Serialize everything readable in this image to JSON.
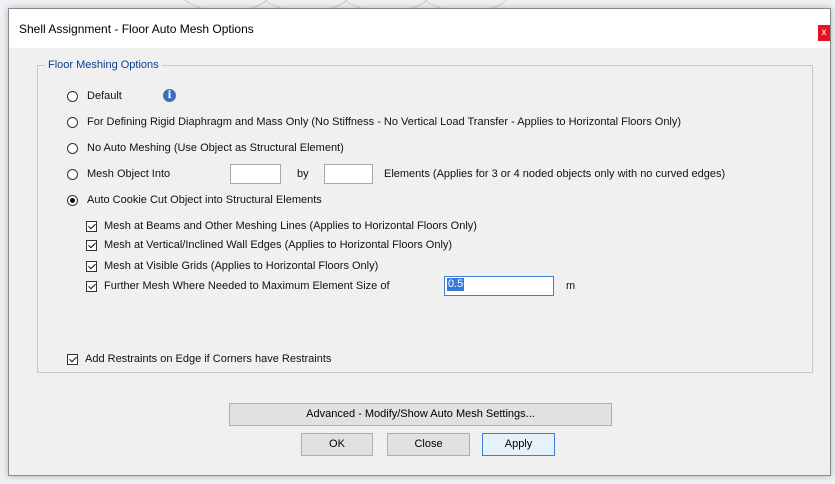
{
  "dialog": {
    "title": "Shell Assignment - Floor Auto Mesh Options",
    "close_glyph": "x"
  },
  "group": {
    "title": "Floor Meshing Options"
  },
  "options": {
    "default": {
      "label": "Default",
      "selected": false,
      "info_icon": "info-icon"
    },
    "rigid": {
      "label": "For Defining Rigid Diaphragm and Mass Only  (No Stiffness - No Vertical Load Transfer - Applies to Horizontal Floors Only)",
      "selected": false
    },
    "no_auto": {
      "label": "No Auto Meshing  (Use Object as Structural Element)",
      "selected": false
    },
    "mesh_into": {
      "label": "Mesh Object Into",
      "by_label": "by",
      "elements_label": "Elements (Applies for 3 or 4 noded objects only with no curved edges)",
      "value1": "",
      "value2": "",
      "selected": false
    },
    "cookie_cut": {
      "label": "Auto Cookie Cut Object into Structural Elements",
      "selected": true
    }
  },
  "checks": {
    "beams": {
      "label": "Mesh at Beams and Other Meshing Lines  (Applies to Horizontal Floors Only)",
      "checked": true
    },
    "walls": {
      "label": "Mesh at Vertical/Inclined Wall Edges  (Applies to Horizontal Floors Only)",
      "checked": true
    },
    "grids": {
      "label": "Mesh at Visible Grids  (Applies to Horizontal Floors Only)",
      "checked": true
    },
    "further": {
      "label": "Further Mesh Where Needed to Maximum Element Size of",
      "checked": true,
      "value": "0.5",
      "unit": "m"
    },
    "restraints": {
      "label": "Add Restraints on Edge if Corners have Restraints",
      "checked": true
    }
  },
  "buttons": {
    "advanced": "Advanced - Modify/Show Auto Mesh Settings...",
    "ok": "OK",
    "close": "Close",
    "apply": "Apply"
  },
  "colors": {
    "accent": "#3c7fd8",
    "group_title": "#0a3d91",
    "close_button": "#e81123"
  }
}
